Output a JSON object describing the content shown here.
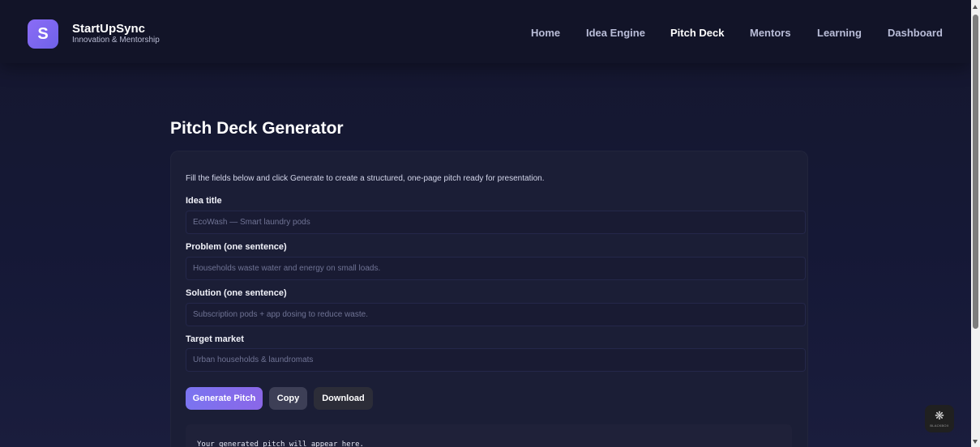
{
  "brand": {
    "logo_letter": "S",
    "name": "StartUpSync",
    "tagline": "Innovation & Mentorship"
  },
  "nav": {
    "items": [
      {
        "label": "Home"
      },
      {
        "label": "Idea Engine"
      },
      {
        "label": "Pitch Deck",
        "active": true
      },
      {
        "label": "Mentors"
      },
      {
        "label": "Learning"
      },
      {
        "label": "Dashboard"
      }
    ]
  },
  "page": {
    "title": "Pitch Deck Generator",
    "intro": "Fill the fields below and click Generate to create a structured, one-page pitch ready for presentation."
  },
  "form": {
    "idea_title": {
      "label": "Idea title",
      "placeholder": "EcoWash — Smart laundry pods",
      "value": ""
    },
    "problem": {
      "label": "Problem (one sentence)",
      "placeholder": "Households waste water and energy on small loads.",
      "value": ""
    },
    "solution": {
      "label": "Solution (one sentence)",
      "placeholder": "Subscription pods + app dosing to reduce waste.",
      "value": ""
    },
    "target_market": {
      "label": "Target market",
      "placeholder": "Urban households & laundromats",
      "value": ""
    }
  },
  "actions": {
    "generate_label": "Generate Pitch",
    "copy_label": "Copy",
    "download_label": "Download"
  },
  "output": {
    "placeholder_text": "Your generated pitch will appear here."
  },
  "widget": {
    "label": "BLACKBOX"
  },
  "colors": {
    "accent": "#7b74f0",
    "background": "#15172e",
    "card": "#1b1e36"
  }
}
